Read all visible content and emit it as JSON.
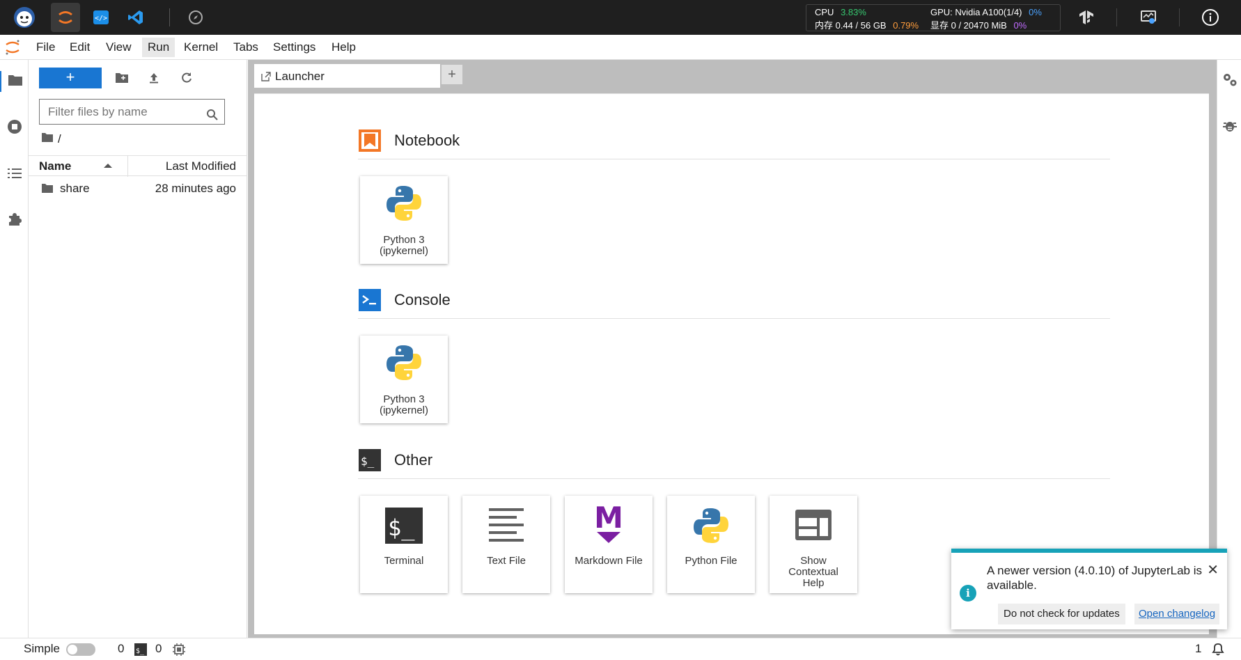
{
  "topbar": {
    "apps": [
      "bot-avatar-icon",
      "jupyter-icon",
      "code-server-icon",
      "vscode-icon",
      "compass-icon"
    ],
    "monitor": {
      "cpu_label": "CPU",
      "cpu_value": "3.83%",
      "mem_label": "内存 0.44 / 56 GB",
      "mem_pct": "0.79%",
      "gpu_label": "GPU: Nvidia A100(1/4)",
      "gpu_value": "0%",
      "vram_label": "显存 0 / 20470 MiB",
      "vram_pct": "0%"
    }
  },
  "menu": {
    "items": [
      "File",
      "Edit",
      "View",
      "Run",
      "Kernel",
      "Tabs",
      "Settings",
      "Help"
    ],
    "selected": "Run"
  },
  "filebrowser": {
    "new_label": "+",
    "filter_placeholder": "Filter files by name",
    "path": "/",
    "col_name": "Name",
    "col_modified": "Last Modified",
    "files": [
      {
        "name": "share",
        "modified": "28 minutes ago",
        "type": "folder"
      }
    ]
  },
  "tabs": {
    "active": "Launcher",
    "add": "+"
  },
  "launcher": {
    "sections": [
      {
        "title": "Notebook",
        "cards": [
          {
            "label1": "Python 3",
            "label2": "(ipykernel)"
          }
        ]
      },
      {
        "title": "Console",
        "cards": [
          {
            "label1": "Python 3",
            "label2": "(ipykernel)"
          }
        ]
      },
      {
        "title": "Other",
        "cards": [
          {
            "label1": "Terminal",
            "label2": ""
          },
          {
            "label1": "Text File",
            "label2": ""
          },
          {
            "label1": "Markdown File",
            "label2": ""
          },
          {
            "label1": "Python File",
            "label2": ""
          },
          {
            "label1": "Show",
            "label2": "Contextual",
            "label3": "Help"
          }
        ]
      }
    ]
  },
  "statusbar": {
    "mode_label": "Simple",
    "kernels": "0",
    "terminals": "0",
    "notifications": "1"
  },
  "notification": {
    "message": "A newer version (4.0.10) of JupyterLab is available.",
    "close": "✕",
    "button_ignore": "Do not check for updates",
    "button_changelog": "Open changelog"
  },
  "colors": {
    "accent": "#1976d2",
    "notebook": "#f37726",
    "info": "#17a2b8"
  }
}
